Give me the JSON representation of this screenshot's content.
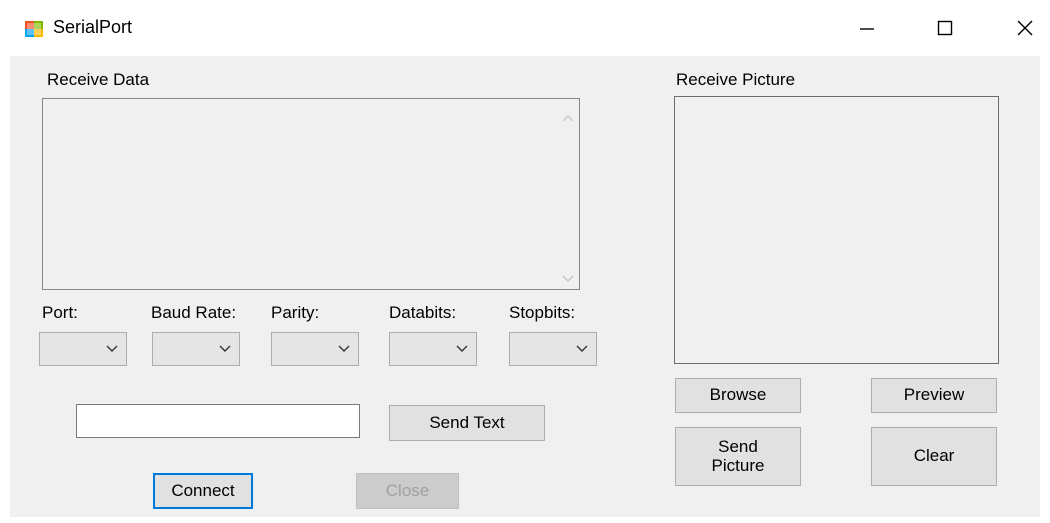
{
  "window": {
    "title": "SerialPort",
    "app_icon": "windows-form-icon",
    "controls": [
      "minimize-icon",
      "maximize-icon",
      "close-icon"
    ]
  },
  "receive_data": {
    "label": "Receive Data",
    "value": ""
  },
  "settings": {
    "port_label": "Port:",
    "baud_label": "Baud Rate:",
    "parity_label": "Parity:",
    "databits_label": "Databits:",
    "stopbits_label": "Stopbits:",
    "port_value": "",
    "baud_value": "",
    "parity_value": "",
    "databits_value": "",
    "stopbits_value": ""
  },
  "send": {
    "text_value": "",
    "send_text_label": "Send Text"
  },
  "connection": {
    "connect_label": "Connect",
    "close_label": "Close"
  },
  "picture": {
    "label": "Receive Picture",
    "browse_label": "Browse",
    "preview_label": "Preview",
    "send_picture_label": "Send Picture",
    "clear_label": "Clear"
  }
}
